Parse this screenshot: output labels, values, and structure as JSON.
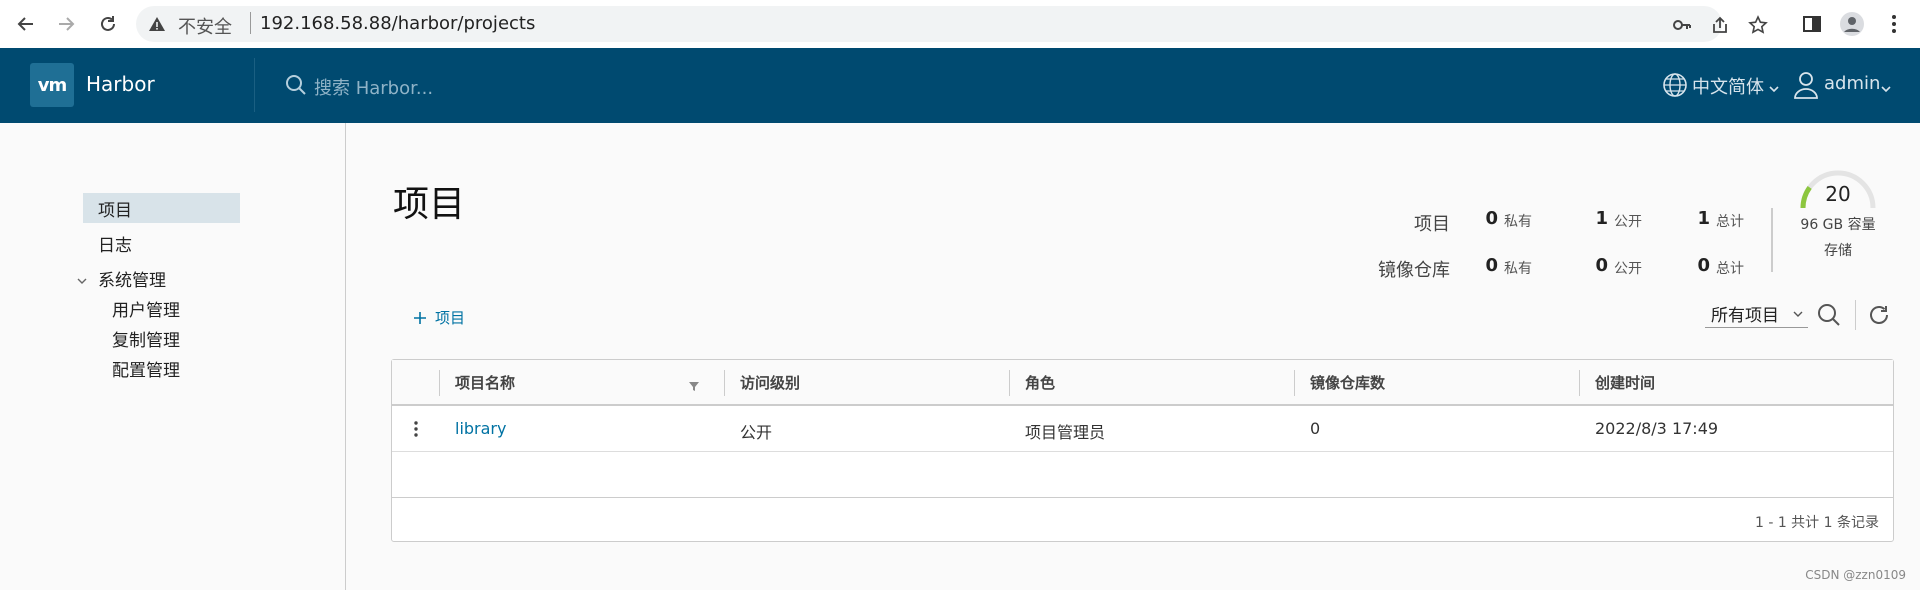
{
  "browser": {
    "insecure_label": "不安全",
    "url": "192.168.58.88/harbor/projects"
  },
  "header": {
    "logo_text": "vm",
    "app_name": "Harbor",
    "search_placeholder": "搜索 Harbor...",
    "language": "中文简体",
    "user": "admin"
  },
  "sidebar": {
    "items": [
      {
        "label": "项目",
        "active": true
      },
      {
        "label": "日志"
      },
      {
        "label": "系统管理",
        "expanded": true,
        "children": [
          {
            "label": "用户管理"
          },
          {
            "label": "复制管理"
          },
          {
            "label": "配置管理"
          }
        ]
      }
    ]
  },
  "main": {
    "title": "项目",
    "stats": {
      "projects": {
        "label": "项目",
        "private": "0",
        "public": "1",
        "total": "1"
      },
      "repos": {
        "label": "镜像仓库",
        "private": "0",
        "public": "0",
        "total": "0"
      },
      "private_label": "私有",
      "public_label": "公开",
      "total_label": "总计"
    },
    "quota": {
      "value": "20",
      "capacity": "96 GB 容量",
      "storage_label": "存储",
      "used_fraction": 0.2
    },
    "toolbar": {
      "add_label": "项目",
      "filter_value": "所有项目"
    },
    "table": {
      "columns": [
        "项目名称",
        "访问级别",
        "角色",
        "镜像仓库数",
        "创建时间"
      ],
      "rows": [
        {
          "name": "library",
          "access": "公开",
          "role": "项目管理员",
          "repos": "0",
          "created": "2022/8/3 17:49"
        }
      ],
      "footer": "1 - 1 共计 1 条记录"
    }
  },
  "watermark": "CSDN @zzn0109",
  "colors": {
    "header_bg": "#004a70",
    "accent": "#0072a3",
    "gauge": "#8cc63e"
  }
}
